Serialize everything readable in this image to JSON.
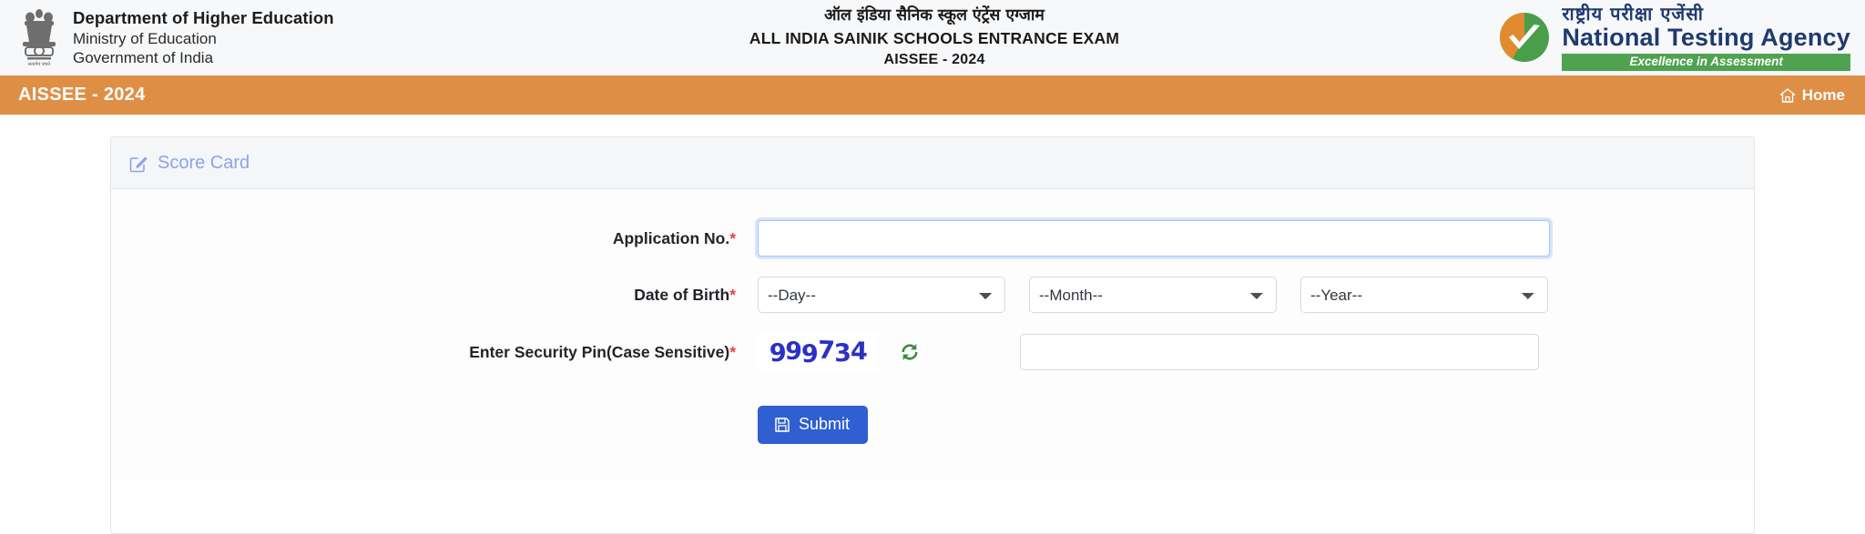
{
  "header": {
    "left": {
      "emblem_icon": "india-state-emblem-icon",
      "line1": "Department of Higher Education",
      "line2": "Ministry of Education",
      "line3": "Government of India"
    },
    "center": {
      "title_hi": "ऑल इंडिया सैनिक स्कूल एंट्रेंस एग्जाम",
      "title_en": "ALL INDIA SAINIK SCHOOLS ENTRANCE EXAM",
      "subtitle": "AISSEE - 2024"
    },
    "right": {
      "logo_icon": "nta-tricolor-checkmark-logo",
      "name_hi": "राष्ट्रीय परीक्षा एजेंसी",
      "name_en": "National Testing Agency",
      "tagline": "Excellence in Assessment"
    }
  },
  "navbar": {
    "brand": "AISSEE - 2024",
    "home_label": "Home",
    "home_icon": "home-icon",
    "background_color": "#de8f45"
  },
  "panel": {
    "icon": "edit-square-icon",
    "title": "Score Card",
    "title_color": "#8ba4e8"
  },
  "form": {
    "application_no": {
      "label": "Application No.",
      "required_mark": "*",
      "value": "",
      "placeholder": ""
    },
    "date_of_birth": {
      "label": "Date of Birth",
      "required_mark": "*",
      "day": {
        "selected": "--Day--",
        "options": [
          "--Day--"
        ]
      },
      "month": {
        "selected": "--Month--",
        "options": [
          "--Month--"
        ]
      },
      "year": {
        "selected": "--Year--",
        "options": [
          "--Year--"
        ]
      }
    },
    "security_pin": {
      "label": "Enter Security Pin(Case Sensitive)",
      "required_mark": "*",
      "captcha_text": "999734",
      "captcha_color": "#2b31c4",
      "refresh_icon": "refresh-icon",
      "refresh_color": "#3c8a3c",
      "value": "",
      "placeholder": ""
    },
    "submit": {
      "label": "Submit",
      "icon": "save-icon",
      "color": "#2f5fd0"
    }
  }
}
